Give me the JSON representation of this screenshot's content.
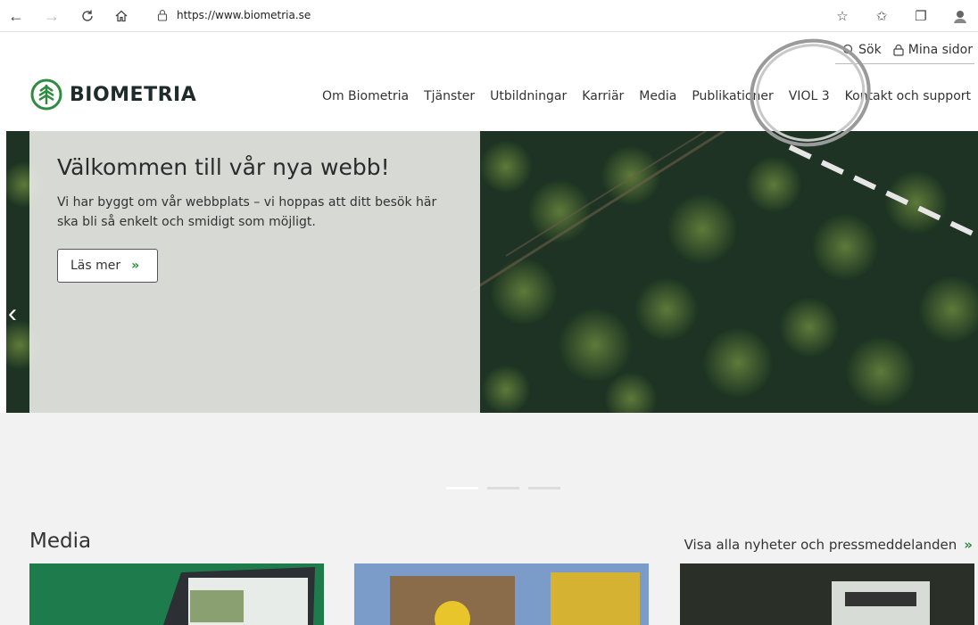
{
  "browser": {
    "url": "https://www.biometria.se",
    "icons": [
      "back-icon",
      "forward-icon",
      "refresh-icon",
      "home-icon",
      "lock-icon",
      "favorite-icon",
      "favorites-list-icon",
      "collections-icon",
      "profile-icon"
    ]
  },
  "utility": {
    "search": "Sök",
    "my_pages": "Mina sidor"
  },
  "logo": {
    "text": "BIOMETRIA"
  },
  "nav": {
    "items": [
      "Om Biometria",
      "Tjänster",
      "Utbildningar",
      "Karriär",
      "Media",
      "Publikationer",
      "VIOL 3",
      "Kontakt och support"
    ]
  },
  "hero": {
    "title": "Välkommen till vår nya webb!",
    "text": "Vi har byggt om vår webbplats – vi hoppas att ditt besök här ska bli så enkelt och smidigt som möjligt.",
    "button": "Läs mer",
    "chevron": "»",
    "prev": "‹"
  },
  "carousel": {
    "dots": 3,
    "active": 0
  },
  "media": {
    "title": "Media",
    "link": "Visa alla nyheter och pressmeddelanden",
    "chevron": "»"
  },
  "colors": {
    "accent": "#2e8b3f",
    "brand_dark": "#1f2b2a",
    "annotation": "#9a9a9a"
  }
}
